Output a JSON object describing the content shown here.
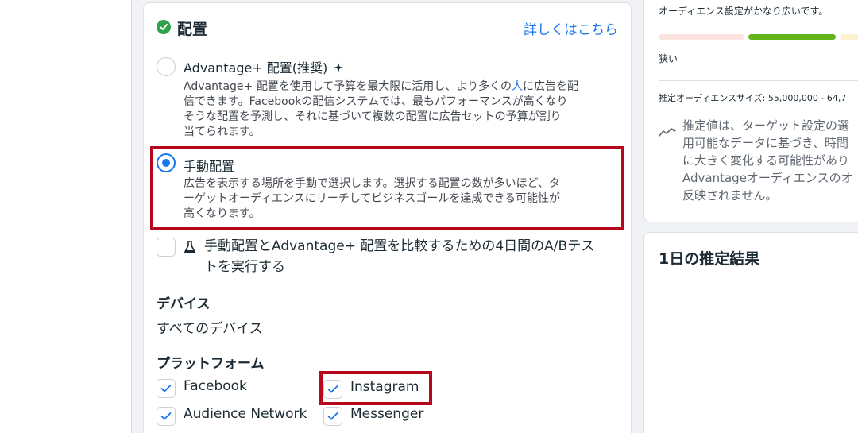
{
  "placement": {
    "title": "配置",
    "learn_more": "詳しくはこちら",
    "advantage_option": {
      "title": "Advantage+ 配置(推奨)",
      "desc_lines": [
        "Advantage+ 配置を使用して予算を最大限に活用し、より多くの",
        "人",
        "に広告を配",
        "信できます。Facebookの配信システムでは、最もパフォーマンスが高くなり",
        "そうな配置を予測し、それに基づいて複数の配置に広告セットの予算が割り",
        "当てられます。"
      ]
    },
    "manual_option": {
      "title": "手動配置",
      "desc_lines": [
        "広告を表示する場所を手動で選択します。選択する配置の数が多いほど、タ",
        "ーゲットオーディエンスにリーチしてビジネスゴールを達成できる可能性が",
        "高くなります。"
      ]
    },
    "ab_test": {
      "lines": [
        "手動配置とAdvantage+ 配置を比較するための4日間のA/Bテス",
        "トを実行する"
      ]
    },
    "devices": {
      "heading": "デバイス",
      "value": "すべてのデバイス"
    },
    "platforms": {
      "heading": "プラットフォーム",
      "items": [
        "Facebook",
        "Instagram",
        "Audience Network",
        "Messenger"
      ]
    }
  },
  "audience": {
    "note": "オーディエンス設定がかなり広いです。",
    "narrow_label": "狭い",
    "estimated_size": "推定オーディエンスサイズ: 55,000,000 - 64,7",
    "estimate_note_lines": [
      "推定値は、ターゲット設定の選",
      "用可能なデータに基づき、時間",
      "に大きく変化する可能性があり",
      "Advantageオーディエンスのオ",
      "反映されません。"
    ],
    "meter_colors": [
      "#fbe3df",
      "#63b31a",
      "#fdf2cf"
    ]
  },
  "daily_results": {
    "title": "1日の推定結果"
  },
  "colors": {
    "accent": "#1877f2",
    "success": "#31a24c",
    "highlight_box": "#b6071d"
  }
}
